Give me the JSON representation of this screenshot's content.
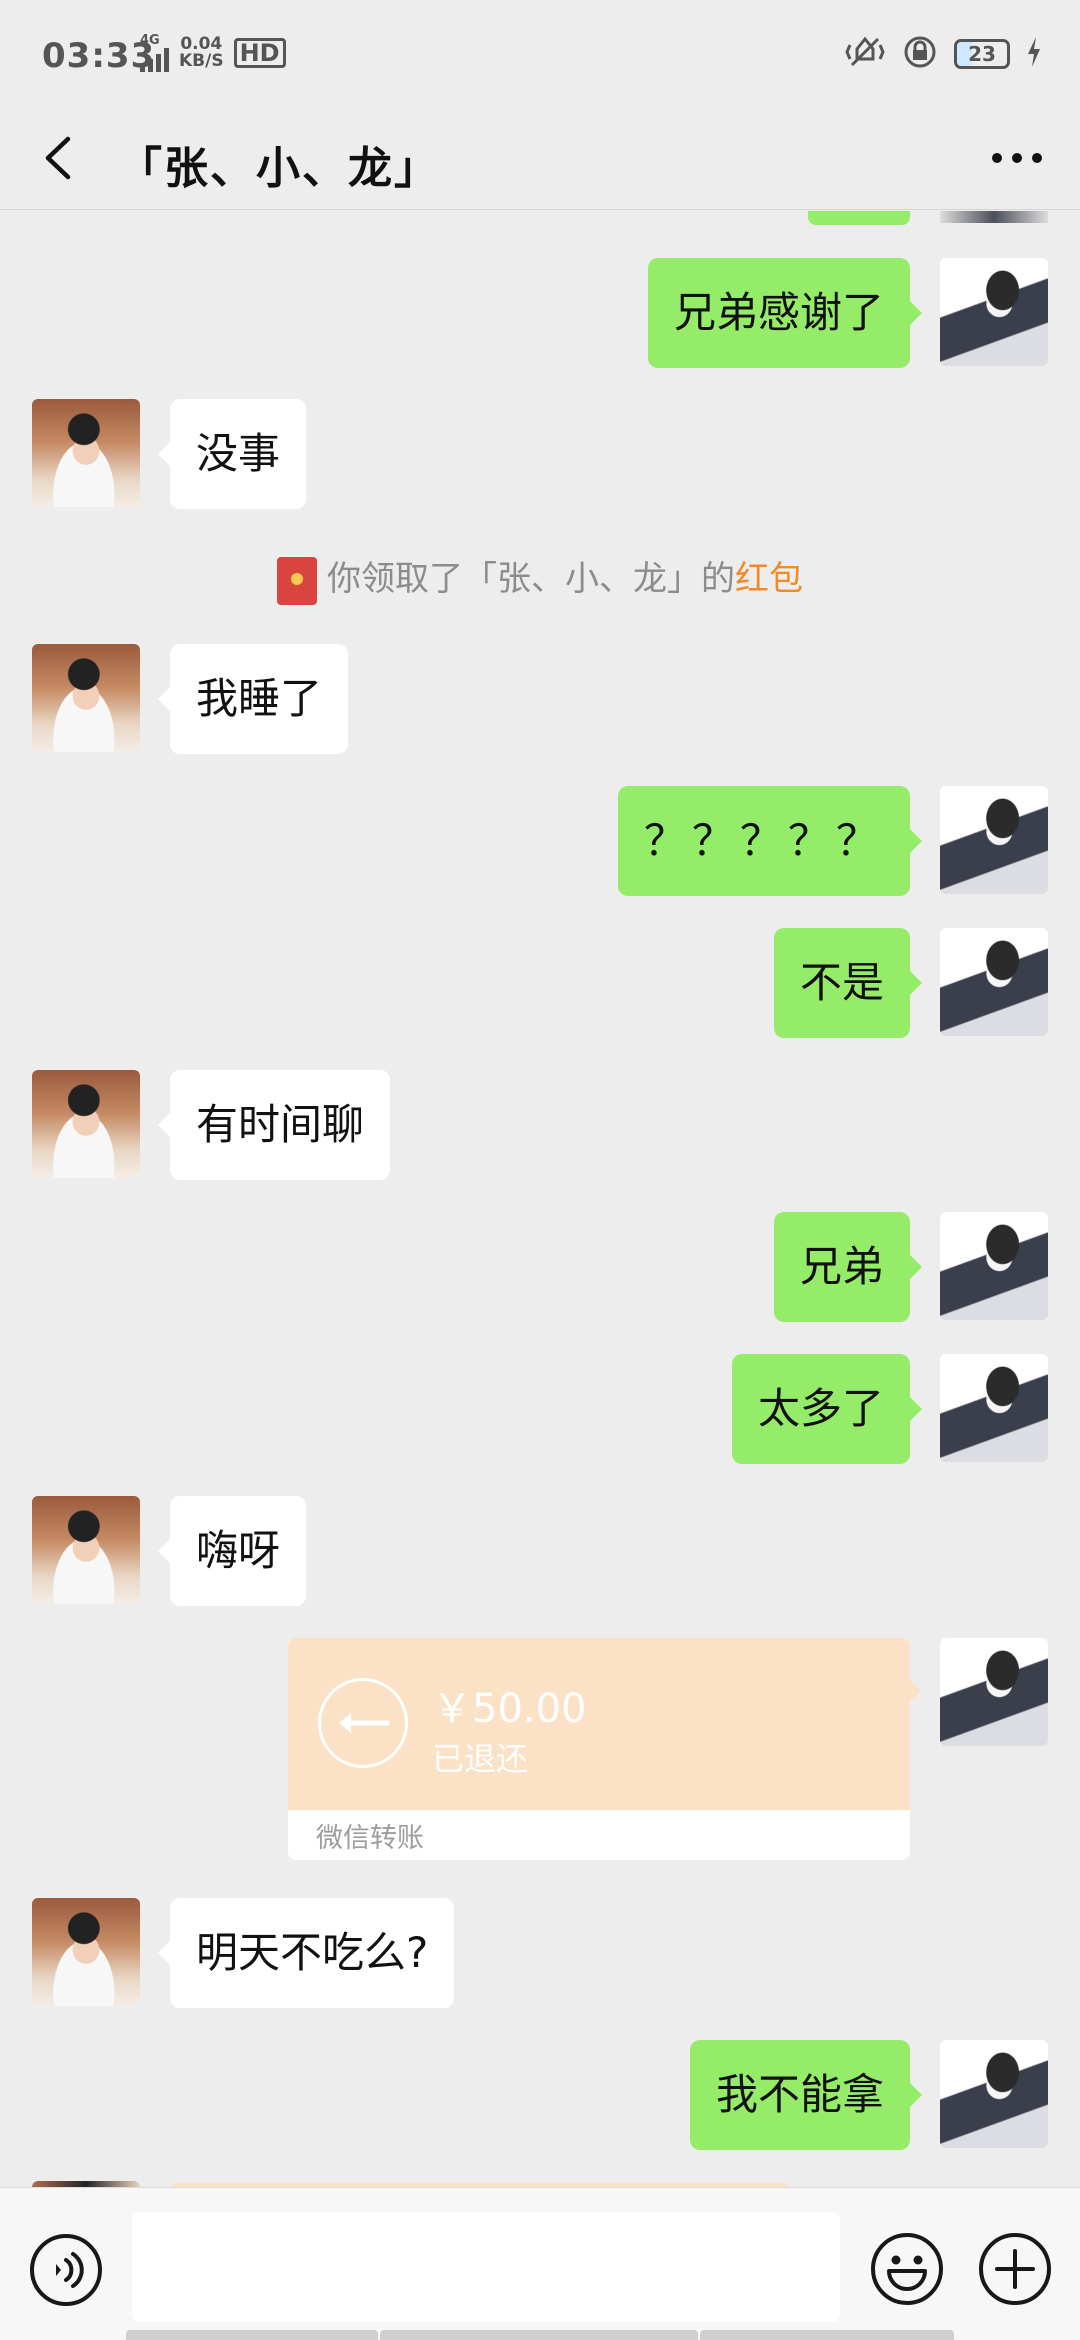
{
  "status_bar": {
    "time": "03:33",
    "network": "4G",
    "speed_value": "0.04",
    "speed_unit": "KB/S",
    "hd": "HD",
    "battery": "23"
  },
  "header": {
    "title": "「张、小、龙」"
  },
  "messages": [
    {
      "side": "right",
      "text": "兄弟感谢了"
    },
    {
      "side": "left",
      "text": "没事"
    },
    {
      "type": "system",
      "prefix": "你领取了「张、小、龙」的",
      "accent": "红包"
    },
    {
      "side": "left",
      "text": "我睡了"
    },
    {
      "side": "right",
      "text": "？？？？？"
    },
    {
      "side": "right",
      "text": "不是"
    },
    {
      "side": "left",
      "text": "有时间聊"
    },
    {
      "side": "right",
      "text": "兄弟"
    },
    {
      "side": "right",
      "text": "太多了"
    },
    {
      "side": "left",
      "text": "嗨呀"
    },
    {
      "type": "transfer",
      "amount": "￥50.00",
      "status": "已退还",
      "footer": "微信转账"
    },
    {
      "side": "left",
      "text": "明天不吃么?"
    },
    {
      "side": "right",
      "text": "我不能拿"
    }
  ],
  "input_bar": {
    "placeholder": ""
  },
  "colors": {
    "background": "#ededed",
    "self_bubble": "#95ec69",
    "friend_bubble": "#ffffff",
    "transfer_card": "#fbe1c5",
    "accent": "#f08a2a"
  },
  "icons": [
    "back-arrow-icon",
    "more-dots-icon",
    "voice-icon",
    "emoji-icon",
    "plus-icon",
    "red-packet-icon",
    "transfer-return-icon"
  ]
}
